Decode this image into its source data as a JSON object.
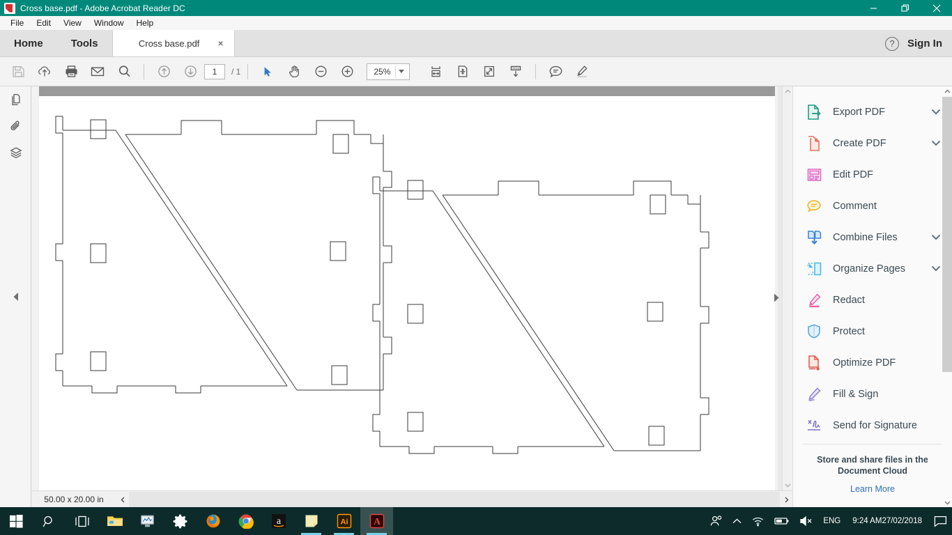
{
  "window": {
    "title": "Cross base.pdf - Adobe Acrobat Reader DC",
    "app_icon": "acrobat-icon",
    "minimize": "minimize-icon",
    "restore": "restore-icon",
    "close": "close-icon",
    "accent_color": "#00897b"
  },
  "menubar": {
    "items": [
      {
        "label": "File"
      },
      {
        "label": "Edit"
      },
      {
        "label": "View"
      },
      {
        "label": "Window"
      },
      {
        "label": "Help"
      }
    ]
  },
  "tabstrip": {
    "home_label": "Home",
    "tools_label": "Tools",
    "document_tab": "Cross base.pdf",
    "close_glyph": "×",
    "help_glyph": "?",
    "sign_in_label": "Sign In"
  },
  "toolbar": {
    "buttons": [
      {
        "name": "save-icon",
        "title": "Save File"
      },
      {
        "name": "cloud-upload-icon",
        "title": "Save to Document Cloud"
      },
      {
        "name": "print-icon",
        "title": "Print File"
      },
      {
        "name": "email-icon",
        "title": "Send File by Email"
      },
      {
        "name": "search-icon",
        "title": "Find"
      },
      {
        "name": "previous-page-icon",
        "title": "Previous Page"
      },
      {
        "name": "next-page-icon",
        "title": "Next Page"
      },
      {
        "name": "select-tool-icon",
        "title": "Select Tool"
      },
      {
        "name": "hand-tool-icon",
        "title": "Hand Tool"
      },
      {
        "name": "zoom-out-icon",
        "title": "Zoom Out"
      },
      {
        "name": "zoom-in-icon",
        "title": "Zoom In"
      },
      {
        "name": "fit-width-icon",
        "title": "Fit Width"
      },
      {
        "name": "fit-page-icon",
        "title": "Fit Page"
      },
      {
        "name": "zoom-region-icon",
        "title": "Zoom to Selection"
      },
      {
        "name": "scroll-mode-icon",
        "title": "Scrolling Mode"
      },
      {
        "name": "comment-icon",
        "title": "Add Comment"
      },
      {
        "name": "highlight-icon",
        "title": "Highlight Text"
      }
    ],
    "page_value": "1",
    "page_total": "/ 1",
    "zoom_value": "25%",
    "active_tool": "select-tool-icon"
  },
  "left_rail": {
    "items": [
      {
        "name": "page-thumbnails-icon",
        "label": "Page Thumbnails"
      },
      {
        "name": "attachments-icon",
        "label": "Attachments"
      },
      {
        "name": "layers-icon",
        "label": "Layers"
      }
    ],
    "collapse": "collapse-left-pane-icon"
  },
  "status": {
    "page_size": "50.00 x 20.00 in",
    "scroll_left": "scroll-left-icon",
    "scroll_right": "scroll-right-icon"
  },
  "right_pane": {
    "tools": [
      {
        "label": "Export PDF",
        "icon": "export-pdf-icon",
        "color": "#1f9b82",
        "chevron": true
      },
      {
        "label": "Create PDF",
        "icon": "create-pdf-icon",
        "color": "#e8705f",
        "chevron": true
      },
      {
        "label": "Edit PDF",
        "icon": "edit-pdf-icon",
        "color": "#e060c0",
        "chevron": false
      },
      {
        "label": "Comment",
        "icon": "comment-tool-icon",
        "color": "#f0b429",
        "chevron": false
      },
      {
        "label": "Combine Files",
        "icon": "combine-files-icon",
        "color": "#3b82d6",
        "chevron": true
      },
      {
        "label": "Organize Pages",
        "icon": "organize-pages-icon",
        "color": "#45b8e8",
        "chevron": true
      },
      {
        "label": "Redact",
        "icon": "redact-icon",
        "color": "#ef5ea8",
        "chevron": false
      },
      {
        "label": "Protect",
        "icon": "protect-icon",
        "color": "#5aa9e6",
        "chevron": false
      },
      {
        "label": "Optimize PDF",
        "icon": "optimize-pdf-icon",
        "color": "#e05c4e",
        "chevron": false
      },
      {
        "label": "Fill & Sign",
        "icon": "fill-sign-icon",
        "color": "#8b7fd4",
        "chevron": false
      },
      {
        "label": "Send for Signature",
        "icon": "send-signature-icon",
        "color": "#7b6fd0",
        "chevron": false
      }
    ],
    "promo_title": "Store and share files in the Document Cloud",
    "promo_link": "Learn More"
  },
  "document": {
    "file_name": "Cross base.pdf",
    "drawing_type": "cad-line-drawing",
    "description": "Two mirrored right-triangle laser-cut panels with tabbed edges and rectangular slot cutouts",
    "stroke_color": "#3a3a3a",
    "background": "#ffffff"
  },
  "taskbar": {
    "items": [
      {
        "name": "start-button-icon",
        "label": "Start",
        "state": "idle"
      },
      {
        "name": "search-icon",
        "label": "Search",
        "state": "idle"
      },
      {
        "name": "task-view-icon",
        "label": "Task View",
        "state": "idle"
      },
      {
        "name": "file-explorer-icon",
        "label": "File Explorer",
        "state": "idle"
      },
      {
        "name": "monitor-app-icon",
        "label": "System Monitor",
        "state": "idle"
      },
      {
        "name": "settings-gear-icon",
        "label": "Settings",
        "state": "idle"
      },
      {
        "name": "firefox-icon",
        "label": "Mozilla Firefox",
        "state": "idle"
      },
      {
        "name": "chrome-icon",
        "label": "Google Chrome",
        "state": "idle"
      },
      {
        "name": "amazon-icon",
        "label": "Amazon",
        "state": "idle"
      },
      {
        "name": "sticky-notes-icon",
        "label": "Sticky Notes",
        "state": "open"
      },
      {
        "name": "illustrator-icon",
        "label": "Adobe Illustrator",
        "state": "open"
      },
      {
        "name": "acrobat-icon",
        "label": "Acrobat Reader DC",
        "state": "active"
      }
    ],
    "tray": {
      "people_icon": "people-icon",
      "show_hidden_icon": "chevron-up-icon",
      "wifi_icon": "wifi-icon",
      "battery_icon": "battery-icon",
      "volume_icon": "volume-muted-icon",
      "language": "ENG",
      "time": "9:24 AM",
      "date": "27/02/2018",
      "action_center_icon": "action-center-icon"
    }
  }
}
